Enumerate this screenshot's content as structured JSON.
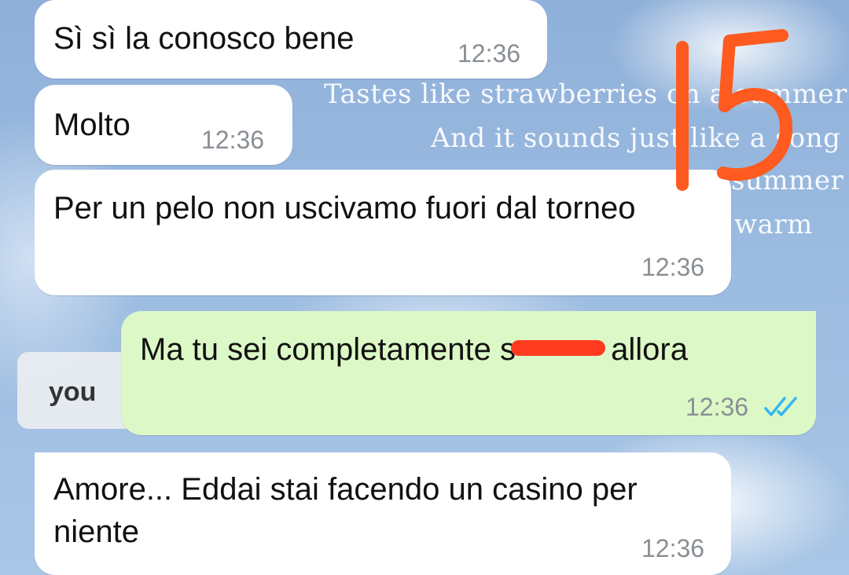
{
  "wallpaper": {
    "lyrics": [
      "Tastes like strawberries on a summer ev",
      "And it sounds just like a song",
      "summer f",
      "warm"
    ],
    "side_word": "you"
  },
  "messages": [
    {
      "direction": "incoming",
      "text": "Sì sì la conosco bene",
      "time": "12:36"
    },
    {
      "direction": "incoming",
      "text": "Molto",
      "time": "12:36"
    },
    {
      "direction": "incoming",
      "text": "Per un pelo non uscivamo fuori dal torneo",
      "time": "12:36"
    },
    {
      "direction": "outgoing",
      "text_before": "Ma tu sei completamente s",
      "text_after": " allora",
      "time": "12:36",
      "status": "read-double-check-icon"
    },
    {
      "direction": "incoming",
      "text": "Amore... Eddai stai facendo un casino per niente",
      "time": "12:36"
    }
  ],
  "annotation": {
    "label": "15",
    "color": "#ff5a1f"
  },
  "colors": {
    "incoming_bubble": "#ffffff",
    "outgoing_bubble": "#dcf8c6",
    "read_ticks": "#34b7f1",
    "redaction": "#ff3b1f"
  }
}
